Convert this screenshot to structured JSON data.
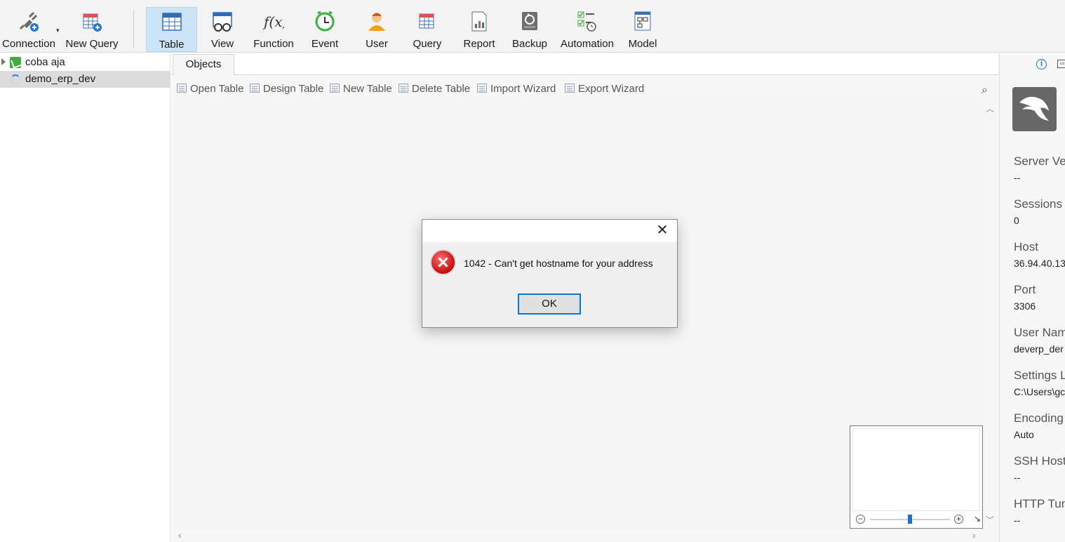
{
  "toolbar": {
    "buttons": [
      {
        "label": "Connection",
        "icon": "plug-icon"
      },
      {
        "label": "New Query",
        "icon": "new-query-icon"
      },
      {
        "label": "Table",
        "icon": "table-icon",
        "active": true
      },
      {
        "label": "View",
        "icon": "view-icon"
      },
      {
        "label": "Function",
        "icon": "function-icon"
      },
      {
        "label": "Event",
        "icon": "clock-icon"
      },
      {
        "label": "User",
        "icon": "user-icon"
      },
      {
        "label": "Query",
        "icon": "query-icon"
      },
      {
        "label": "Report",
        "icon": "report-icon"
      },
      {
        "label": "Backup",
        "icon": "backup-icon"
      },
      {
        "label": "Automation",
        "icon": "automation-icon"
      },
      {
        "label": "Model",
        "icon": "model-icon"
      }
    ]
  },
  "tree": {
    "items": [
      {
        "label": "coba aja",
        "icon": "connection-icon"
      },
      {
        "label": "demo_erp_dev",
        "icon": "loading-spinner-icon",
        "selected": true
      }
    ]
  },
  "tabs": [
    {
      "label": "Objects"
    }
  ],
  "actions": {
    "items": [
      {
        "label": "Open Table"
      },
      {
        "label": "Design Table"
      },
      {
        "label": "New Table"
      },
      {
        "label": "Delete Table"
      },
      {
        "label": "Import Wizard"
      },
      {
        "label": "Export Wizard"
      }
    ]
  },
  "info_panel": {
    "fields": [
      {
        "label": "Server Ve",
        "value": "--"
      },
      {
        "label": "Sessions",
        "value": "0"
      },
      {
        "label": "Host",
        "value": "36.94.40.13"
      },
      {
        "label": "Port",
        "value": "3306"
      },
      {
        "label": "User Nam",
        "value": "deverp_der"
      },
      {
        "label": "Settings L",
        "value": "C:\\Users\\gc"
      },
      {
        "label": "Encoding",
        "value": "Auto"
      },
      {
        "label": "SSH Host",
        "value": "--"
      },
      {
        "label": "HTTP Tun",
        "value": "--"
      }
    ]
  },
  "dialog": {
    "message": "1042 - Can't get hostname for your address",
    "ok_label": "OK"
  },
  "colors": {
    "accent": "#0078d7",
    "active_tab_bg": "#cce4f7",
    "error_red": "#c40f0f"
  }
}
